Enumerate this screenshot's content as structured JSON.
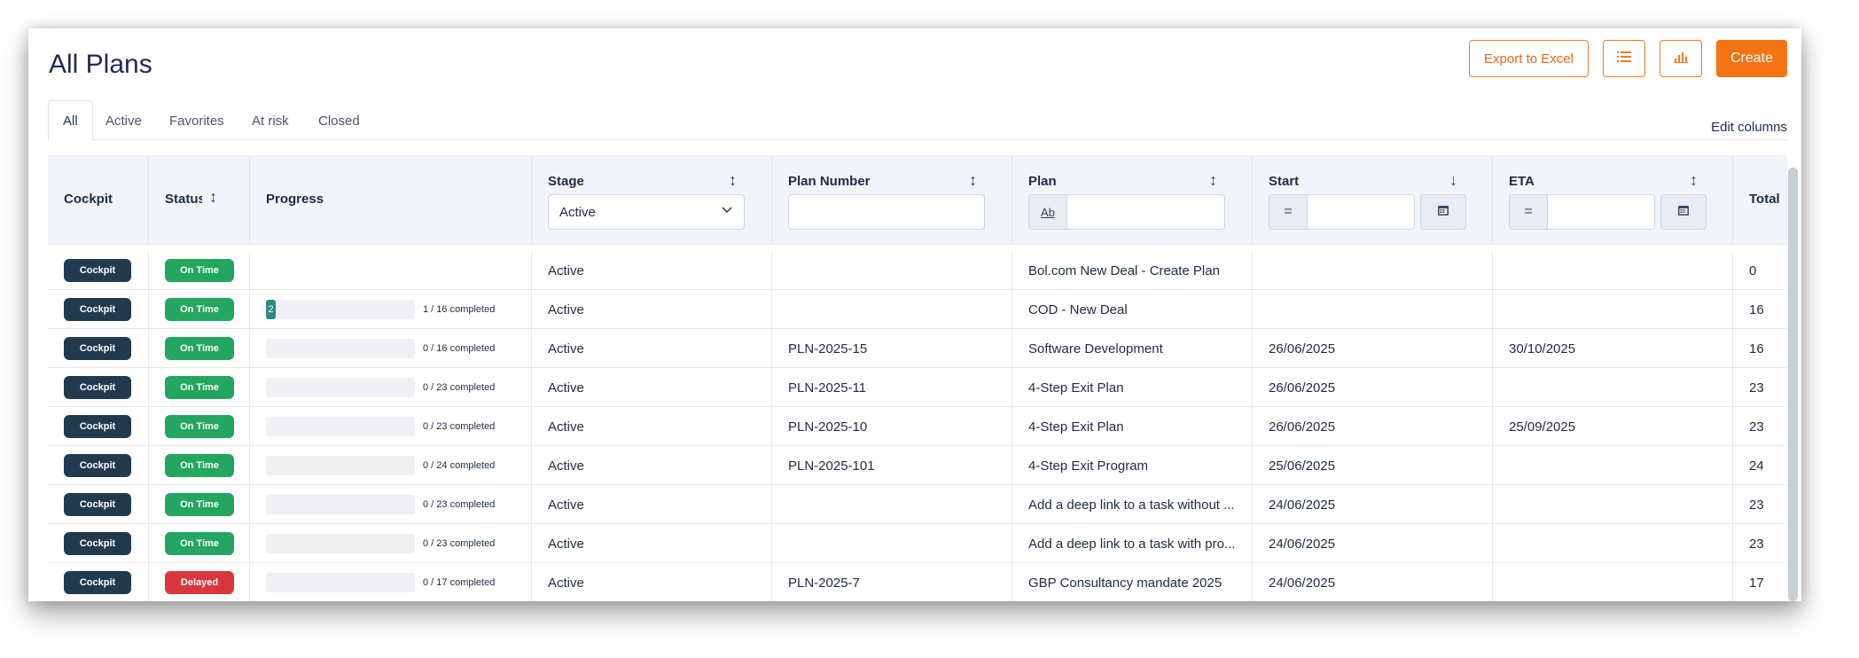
{
  "page": {
    "title": "All Plans"
  },
  "toolbar": {
    "export_label": "Export to Excel",
    "list_icon": "list-icon",
    "chart_icon": "bar-chart-icon",
    "create_label": "Create"
  },
  "tabs": [
    {
      "label": "All",
      "active": true
    },
    {
      "label": "Active",
      "active": false
    },
    {
      "label": "Favorites",
      "active": false
    },
    {
      "label": "At risk",
      "active": false
    },
    {
      "label": "Closed",
      "active": false
    }
  ],
  "edit_columns_label": "Edit columns",
  "columns": {
    "cockpit": "Cockpit",
    "status": "Status",
    "progress": "Progress",
    "stage": "Stage",
    "plan_number": "Plan Number",
    "plan": "Plan",
    "start": "Start",
    "eta": "ETA",
    "total": "Total"
  },
  "filters": {
    "stage_value": "Active",
    "plan_operator": "Ab",
    "start_operator": "=",
    "eta_operator": "="
  },
  "colors": {
    "on_time": "#23a65f",
    "delayed": "#d9363e",
    "accent": "#f57315"
  },
  "rows": [
    {
      "cockpit": "Cockpit",
      "status": "On Time",
      "status_color": "#23a65f",
      "progress_text": "",
      "progress_fill_label": "",
      "progress_fraction": 0,
      "show_progress": false,
      "stage": "Active",
      "plan_number": "",
      "plan": "Bol.com New Deal - Create Plan",
      "start": "",
      "eta": "",
      "total": "0"
    },
    {
      "cockpit": "Cockpit",
      "status": "On Time",
      "status_color": "#23a65f",
      "progress_text": "1 / 16 completed",
      "progress_fill_label": "2",
      "progress_fraction": 0.0625,
      "show_progress": true,
      "stage": "Active",
      "plan_number": "",
      "plan": "COD - New Deal",
      "start": "",
      "eta": "",
      "total": "16"
    },
    {
      "cockpit": "Cockpit",
      "status": "On Time",
      "status_color": "#23a65f",
      "progress_text": "0 / 16 completed",
      "progress_fill_label": "",
      "progress_fraction": 0,
      "show_progress": true,
      "stage": "Active",
      "plan_number": "PLN-2025-15",
      "plan": "Software Development",
      "start": "26/06/2025",
      "eta": "30/10/2025",
      "total": "16"
    },
    {
      "cockpit": "Cockpit",
      "status": "On Time",
      "status_color": "#23a65f",
      "progress_text": "0 / 23 completed",
      "progress_fill_label": "",
      "progress_fraction": 0,
      "show_progress": true,
      "stage": "Active",
      "plan_number": "PLN-2025-11",
      "plan": "4-Step Exit Plan",
      "start": "26/06/2025",
      "eta": "",
      "total": "23"
    },
    {
      "cockpit": "Cockpit",
      "status": "On Time",
      "status_color": "#23a65f",
      "progress_text": "0 / 23 completed",
      "progress_fill_label": "",
      "progress_fraction": 0,
      "show_progress": true,
      "stage": "Active",
      "plan_number": "PLN-2025-10",
      "plan": "4-Step Exit Plan",
      "start": "26/06/2025",
      "eta": "25/09/2025",
      "total": "23"
    },
    {
      "cockpit": "Cockpit",
      "status": "On Time",
      "status_color": "#23a65f",
      "progress_text": "0 / 24 completed",
      "progress_fill_label": "",
      "progress_fraction": 0,
      "show_progress": true,
      "stage": "Active",
      "plan_number": "PLN-2025-101",
      "plan": "4-Step Exit Program",
      "start": "25/06/2025",
      "eta": "",
      "total": "24"
    },
    {
      "cockpit": "Cockpit",
      "status": "On Time",
      "status_color": "#23a65f",
      "progress_text": "0 / 23 completed",
      "progress_fill_label": "",
      "progress_fraction": 0,
      "show_progress": true,
      "stage": "Active",
      "plan_number": "",
      "plan": "Add a deep link to a task without ...",
      "start": "24/06/2025",
      "eta": "",
      "total": "23"
    },
    {
      "cockpit": "Cockpit",
      "status": "On Time",
      "status_color": "#23a65f",
      "progress_text": "0 / 23 completed",
      "progress_fill_label": "",
      "progress_fraction": 0,
      "show_progress": true,
      "stage": "Active",
      "plan_number": "",
      "plan": "Add a deep link to a task with pro...",
      "start": "24/06/2025",
      "eta": "",
      "total": "23"
    },
    {
      "cockpit": "Cockpit",
      "status": "Delayed",
      "status_color": "#d9363e",
      "progress_text": "0 / 17 completed",
      "progress_fill_label": "",
      "progress_fraction": 0,
      "show_progress": true,
      "stage": "Active",
      "plan_number": "PLN-2025-7",
      "plan": "GBP Consultancy mandate 2025",
      "start": "24/06/2025",
      "eta": "",
      "total": "17"
    }
  ]
}
